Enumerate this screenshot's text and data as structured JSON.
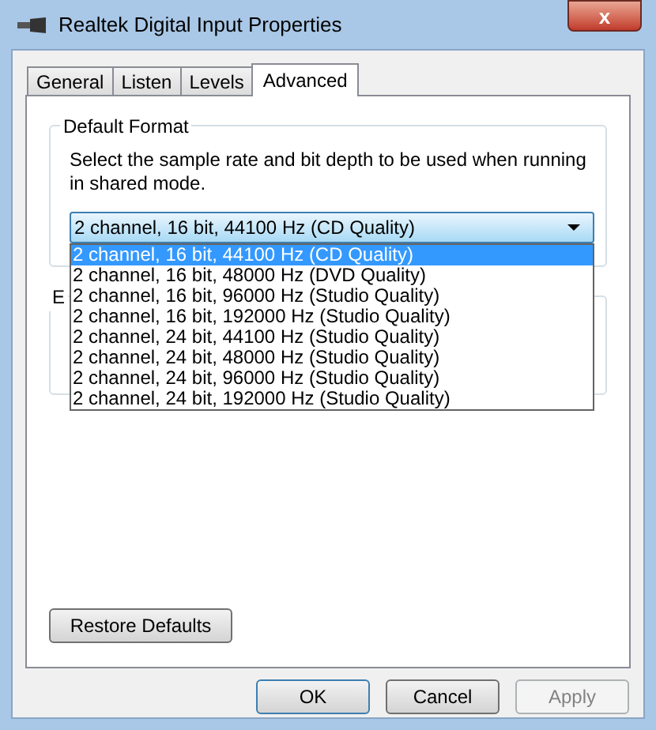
{
  "window": {
    "title": "Realtek Digital Input Properties",
    "close": "x"
  },
  "tabs": [
    {
      "label": "General",
      "selected": false
    },
    {
      "label": "Listen",
      "selected": false
    },
    {
      "label": "Levels",
      "selected": false
    },
    {
      "label": "Advanced",
      "selected": true
    }
  ],
  "default_format": {
    "title": "Default Format",
    "description": "Select the sample rate and bit depth to be used when running in shared mode.",
    "value": "2 channel, 16 bit, 44100 Hz (CD Quality)",
    "expanded": true,
    "options": [
      {
        "label": "2 channel, 16 bit, 44100 Hz (CD Quality)",
        "selected": true
      },
      {
        "label": "2 channel, 16 bit, 48000 Hz (DVD Quality)",
        "selected": false
      },
      {
        "label": "2 channel, 16 bit, 96000 Hz (Studio Quality)",
        "selected": false
      },
      {
        "label": "2 channel, 16 bit, 192000 Hz (Studio Quality)",
        "selected": false
      },
      {
        "label": "2 channel, 24 bit, 44100 Hz (Studio Quality)",
        "selected": false
      },
      {
        "label": "2 channel, 24 bit, 48000 Hz (Studio Quality)",
        "selected": false
      },
      {
        "label": "2 channel, 24 bit, 96000 Hz (Studio Quality)",
        "selected": false
      },
      {
        "label": "2 channel, 24 bit, 192000 Hz (Studio Quality)",
        "selected": false
      }
    ]
  },
  "second_group": {
    "title": "E"
  },
  "restore_button": "Restore Defaults",
  "buttons": [
    {
      "label": "OK",
      "disabled": false,
      "default": true
    },
    {
      "label": "Cancel",
      "disabled": false,
      "default": false
    },
    {
      "label": "Apply",
      "disabled": true,
      "default": false
    }
  ]
}
